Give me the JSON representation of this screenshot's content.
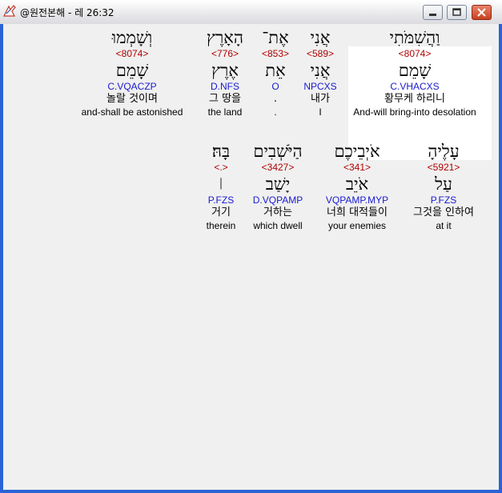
{
  "window": {
    "title": "@원전본해 - 레 26:32"
  },
  "rows": [
    {
      "words": [
        {
          "hebrew": "וַהֲשִׁמֹּתִי",
          "strong": "<8074>",
          "lemma": "שָׁמֵם",
          "morph": "C.VHACXS",
          "korean": "황무케 하리니",
          "english": "And-will bring-into desolation"
        },
        {
          "hebrew": "אֲנִי",
          "strong": "<589>",
          "lemma": "אֲנִי",
          "morph": "NPCXS",
          "korean": "내가",
          "english": "I"
        },
        {
          "hebrew": "אֶת־",
          "strong": "<853>",
          "lemma": "אֵת",
          "morph": "O",
          "korean": ".",
          "english": "."
        },
        {
          "hebrew": "הָאָרֶץ",
          "strong": "<776>",
          "lemma": "אֶרֶץ",
          "morph": "D.NFS",
          "korean": "그 땅을",
          "english": "the land"
        },
        {
          "hebrew": "וְשָׁמְמוּ",
          "strong": "<8074>",
          "lemma": "שָׁמֵם",
          "morph": "C.VQACZP",
          "korean": "놀랄 것이며",
          "english": "and-shall be astonished"
        }
      ]
    },
    {
      "words": [
        {
          "hebrew": "עָלֶיהָ",
          "strong": "<5921>",
          "lemma": "עַל",
          "morph": "P.FZS",
          "korean": "그것을 인하여",
          "english": "at it"
        },
        {
          "hebrew": "אֹיְבֵיכֶם",
          "strong": "<341>",
          "lemma": "אֹיֵב",
          "morph": "VQPAMP.MYP",
          "korean": "너희 대적들이",
          "english": "your enemies"
        },
        {
          "hebrew": "הַיֹּשְׁבִים",
          "strong": "<3427>",
          "lemma": "יָשַׁב",
          "morph": "D.VQPAMP",
          "korean": "거하는",
          "english": "which dwell"
        },
        {
          "hebrew": "בָּהּ׃",
          "strong": "<.>",
          "lemma": "׀",
          "morph": "P.FZS",
          "korean": "거기",
          "english": "therein"
        }
      ]
    }
  ]
}
